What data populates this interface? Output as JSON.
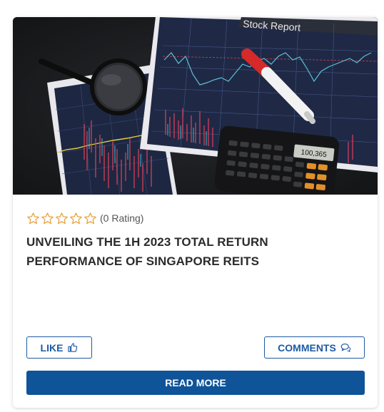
{
  "card": {
    "image": {
      "report_heading": "Stock Report",
      "calculator_display": "100,365"
    },
    "rating": {
      "stars_total": 5,
      "stars_filled": 0,
      "text": "(0 Rating)"
    },
    "title": "UNVEILING THE 1H 2023 TOTAL RETURN PERFORMANCE OF SINGAPORE REITS",
    "buttons": {
      "like": "LIKE",
      "comments": "COMMENTS",
      "read_more": "READ MORE"
    },
    "colors": {
      "accent": "#1e5aa3",
      "primary_button": "#0f5399",
      "star": "#e9a23b",
      "title": "#2b2b2b"
    },
    "icons": [
      "star-outline-icon",
      "thumbs-up-icon",
      "comment-icon"
    ]
  }
}
